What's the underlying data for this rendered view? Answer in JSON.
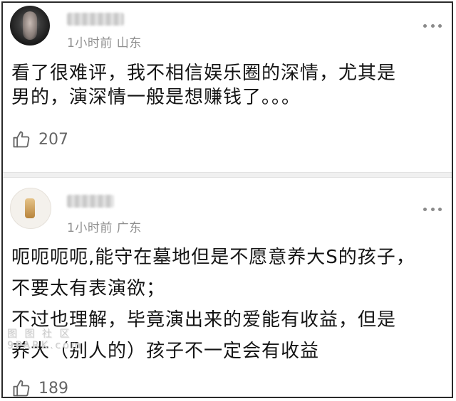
{
  "comments": [
    {
      "meta": "1小时前 山东",
      "lines": [
        "看了很难评，我不相信娱乐圈的深情，尤其是",
        "男的，演深情一般是想赚钱了。。。"
      ],
      "likes": "207"
    },
    {
      "meta": "1小时前 广东",
      "lines": [
        "呃呃呃呃,能守在墓地但是不愿意养大S的孩子，",
        "不要太有表演欲；",
        "不过也理解，毕竟演出来的爱能有收益，但是",
        "养大（别人的）孩子不一定会有收益"
      ],
      "likes": "189"
    }
  ],
  "watermark": {
    "line1": "图 图 社 区",
    "line2": "9PARK.com"
  },
  "icons": {
    "more": "more-dots-icon",
    "like": "thumbs-up-icon"
  }
}
